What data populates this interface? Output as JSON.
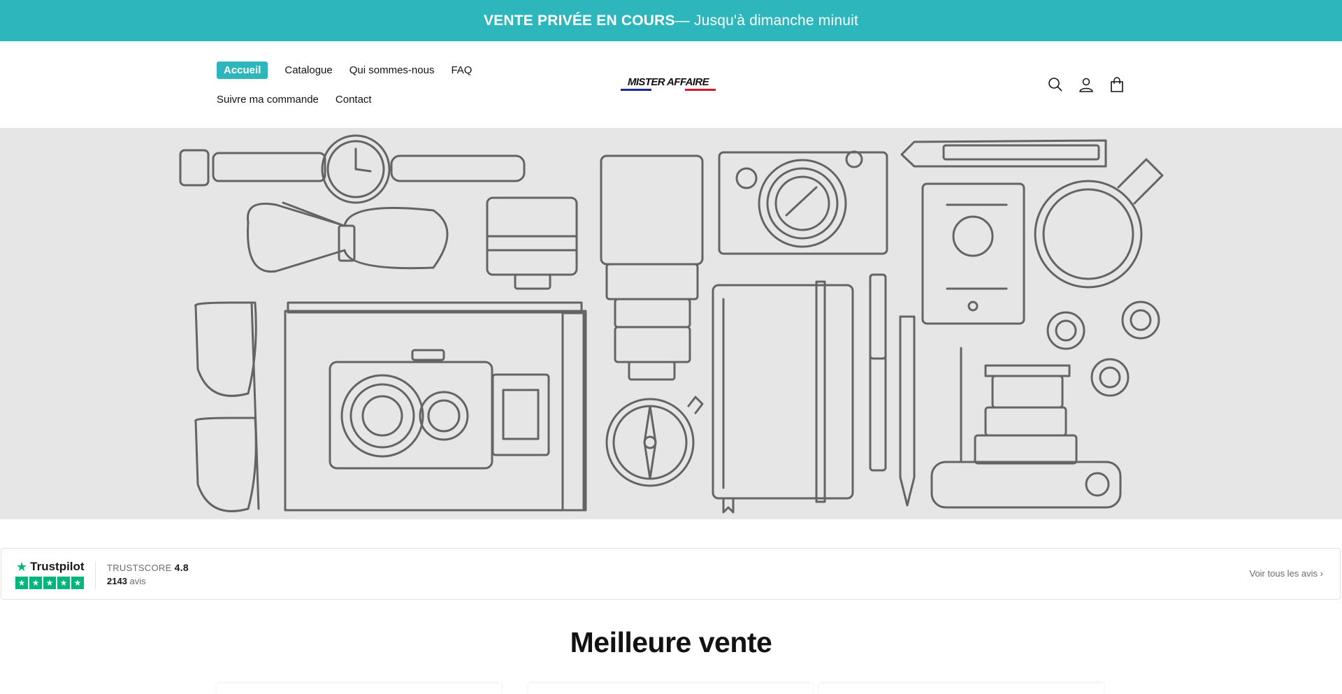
{
  "announcement": {
    "strong": "VENTE PRIVÉE EN COURS",
    "rest": " — Jusqu'à dimanche minuit",
    "background": "#2db7bc"
  },
  "nav": {
    "row1": [
      "Accueil",
      "Catalogue",
      "Qui sommes-nous",
      "FAQ"
    ],
    "row2": [
      "Suivre ma commande",
      "Contact"
    ],
    "active": "Accueil"
  },
  "logo": {
    "text": "MISTER AFFAIRE",
    "colors": {
      "blue": "#1b2a8f",
      "white": "#ffffff",
      "red": "#d6182a"
    }
  },
  "header_icons": [
    "search-icon",
    "account-icon",
    "cart-icon"
  ],
  "trustpilot": {
    "brand": "Trustpilot",
    "score_label": "TRUSTSCORE",
    "score": "4.8",
    "count": "2143",
    "count_label": "avis",
    "link": "Voir tous les avis",
    "star_color": "#00b67a"
  },
  "section": {
    "title": "Meilleure vente"
  }
}
